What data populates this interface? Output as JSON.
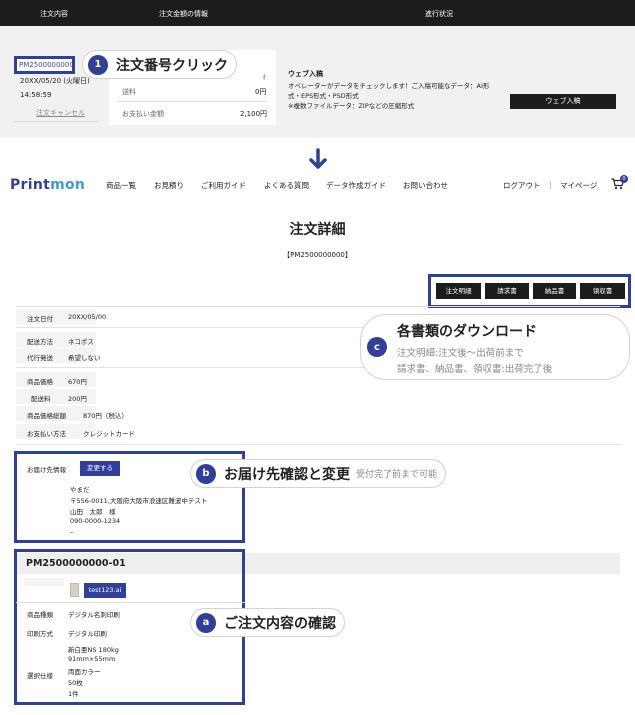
{
  "order_list": {
    "columns": [
      "注文内容",
      "注文金額の情報",
      "進行状況"
    ],
    "order_id": "PM2500000000",
    "date": "20XX/05/20 (火曜日)",
    "time": "14:58:59",
    "cancel": "注文キャンセル",
    "shipping_label": "送料",
    "shipping_value": "0円",
    "total_label": "お支払い金額",
    "total_value": "2,100円",
    "partial_mark": "f",
    "web_title": "ウェブ入稿",
    "web_desc1": "オペレーターがデータをチェックします！ご入稿可能なデータ：AI形",
    "web_desc2": "式・EPS形式・PSD形式",
    "web_desc3": "※複数ファイルデータ：ZIPなどの圧縮形式",
    "web_button": "ウェブ入稿"
  },
  "callouts": {
    "c1_badge": "1",
    "c1_title": "注文番号クリック",
    "c_badge": "c",
    "c_title": "各書類のダウンロード",
    "c_sub1": "注文明細:注文後〜出荷前まで",
    "c_sub2": "請求書、納品書、領収書:出荷完了後",
    "b_badge": "b",
    "b_title": "お届け先確認と変更",
    "b_sub": "受付完了前まで可能",
    "a_badge": "a",
    "a_title": "ご注文内容の確認"
  },
  "header": {
    "logo_part1": "Print",
    "logo_part2": "mon",
    "nav": [
      "商品一覧",
      "お見積り",
      "ご利用ガイド",
      "よくある質問",
      "データ作成ガイド",
      "お問い合わせ"
    ],
    "logout": "ログアウト",
    "separator": "|",
    "mypage": "マイページ",
    "cart_count": "0"
  },
  "detail": {
    "title": "注文詳細",
    "order_no": "【PM2500000000】",
    "doc_buttons": [
      "注文明細",
      "請求書",
      "納品書",
      "領収書"
    ],
    "rows": [
      {
        "label": "注文日付",
        "value": "20XX/05/00"
      },
      {
        "label": "配送方法",
        "value": "ネコポス"
      },
      {
        "label": "代行発送",
        "value": "希望しない"
      },
      {
        "label": "商品価格",
        "value": "670円"
      },
      {
        "label": "配送料",
        "value": "200円"
      },
      {
        "label": "商品価格総額",
        "value": "870円（税込）"
      },
      {
        "label": "お支払い方法",
        "value": "クレジットカード"
      }
    ],
    "delivery_label": "お届け先情報",
    "change_button": "変更する",
    "delivery_lines": [
      "やまだ",
      "〒556-0011,大阪府大阪市浪速区難波中テスト",
      "山田　太郎　様",
      "090-0000-1234",
      "–"
    ],
    "item_id": "PM2500000000-01",
    "file_name": "test123.ai",
    "item_rows": [
      {
        "label": "商品種類",
        "value": "デジタル名刺印刷"
      },
      {
        "label": "印刷方式",
        "value": "デジタル印刷"
      }
    ],
    "spec_label": "選択仕様",
    "spec_lines": [
      "新白亜NS 180kg",
      "91mm×55mm",
      "両面カラー",
      "50枚",
      "1件"
    ]
  }
}
